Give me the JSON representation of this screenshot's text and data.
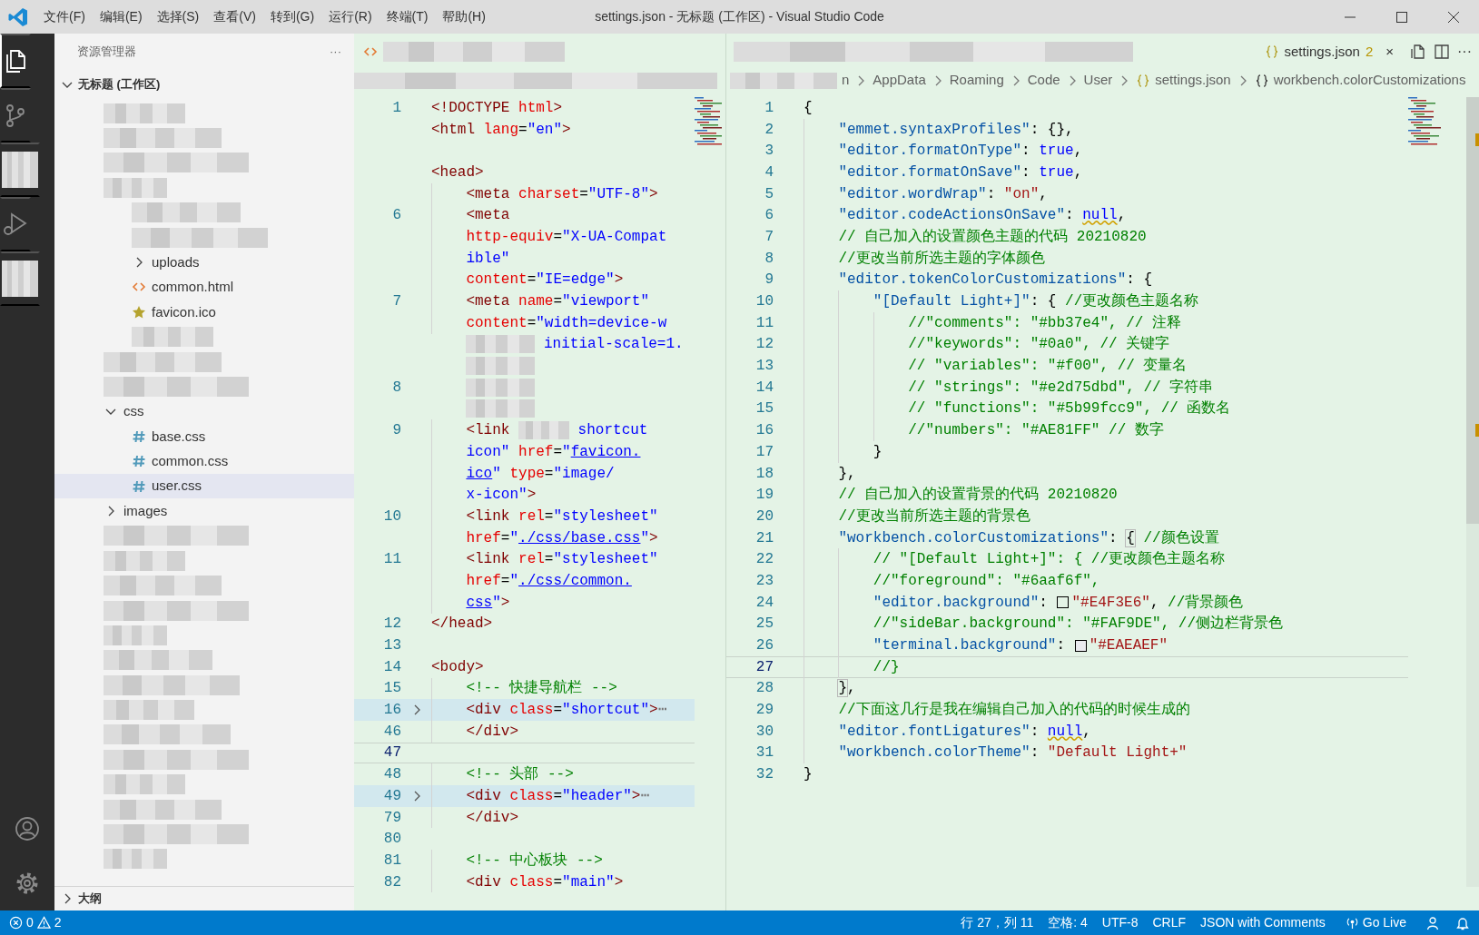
{
  "title_bar": {
    "menus": [
      "文件(F)",
      "编辑(E)",
      "选择(S)",
      "查看(V)",
      "转到(G)",
      "运行(R)",
      "终端(T)",
      "帮助(H)"
    ],
    "title": "settings.json - 无标题 (工作区) - Visual Studio Code"
  },
  "activity_bar": {
    "items": [
      {
        "kind": "files",
        "selected": true
      },
      {
        "kind": "source-control",
        "selected": false
      },
      {
        "kind": "redacted",
        "selected": false
      },
      {
        "kind": "run-debug",
        "selected": false
      },
      {
        "kind": "redacted",
        "selected": false
      }
    ],
    "bottom": [
      {
        "kind": "account"
      },
      {
        "kind": "settings"
      }
    ]
  },
  "explorer": {
    "title": "资源管理器",
    "more": "···",
    "workspace": {
      "label": "无标题 (工作区)",
      "expanded": true
    },
    "tree": [
      {
        "kind": "redacted",
        "selected": false
      },
      {
        "kind": "redacted",
        "selected": false
      },
      {
        "kind": "redacted",
        "selected": false
      },
      {
        "kind": "redacted",
        "selected": false,
        "children": [
          {
            "kind": "redacted",
            "selected": false
          },
          {
            "kind": "redacted",
            "selected": false
          },
          {
            "kind": "folder",
            "label": "uploads",
            "expanded": false,
            "selected": false
          },
          {
            "kind": "html",
            "label": "common.html",
            "selected": false
          },
          {
            "kind": "favicon",
            "label": "favicon.ico",
            "selected": false
          },
          {
            "kind": "redacted",
            "selected": false
          }
        ]
      },
      {
        "kind": "redacted",
        "selected": false
      },
      {
        "kind": "redacted",
        "selected": false
      },
      {
        "kind": "folder",
        "label": "css",
        "expanded": true,
        "selected": false,
        "children": [
          {
            "kind": "css",
            "label": "base.css",
            "selected": false
          },
          {
            "kind": "css",
            "label": "common.css",
            "selected": false
          },
          {
            "kind": "css",
            "label": "user.css",
            "selected": true
          }
        ]
      },
      {
        "kind": "folder",
        "label": "images",
        "expanded": false,
        "selected": false
      },
      {
        "kind": "redacted",
        "selected": false
      },
      {
        "kind": "redacted",
        "selected": false
      },
      {
        "kind": "redacted",
        "selected": false
      },
      {
        "kind": "redacted",
        "selected": false
      },
      {
        "kind": "redacted",
        "selected": false
      },
      {
        "kind": "redacted",
        "selected": false
      },
      {
        "kind": "redacted",
        "selected": false
      },
      {
        "kind": "redacted",
        "selected": false
      },
      {
        "kind": "redacted",
        "selected": false
      },
      {
        "kind": "redacted",
        "selected": false
      },
      {
        "kind": "redacted",
        "selected": false
      },
      {
        "kind": "redacted",
        "selected": false
      },
      {
        "kind": "redacted",
        "selected": false
      },
      {
        "kind": "redacted",
        "selected": false
      }
    ],
    "outline": {
      "label": "大纲",
      "expanded": false
    }
  },
  "editor_left": {
    "tabs": [
      {
        "kind": "html"
      }
    ],
    "rows": [
      {
        "number": "1",
        "current": false,
        "folded": false,
        "tokens": [
          {
            "kind": "tag",
            "text": "<!DOCTYPE"
          },
          {
            "kind": "attr",
            "text": " html"
          },
          {
            "kind": "tag",
            "text": ">"
          }
        ]
      },
      {
        "current": false,
        "folded": false,
        "tokens": [
          {
            "kind": "tag",
            "text": "<html"
          },
          {
            "kind": "attr",
            "text": " lang"
          },
          {
            "kind": "plain",
            "text": "="
          },
          {
            "kind": "string",
            "text": "\"en\""
          },
          {
            "kind": "tag",
            "text": ">"
          }
        ]
      },
      {
        "current": false,
        "folded": false
      },
      {
        "current": false,
        "folded": false,
        "tokens": [
          {
            "kind": "tag",
            "text": "<head>"
          }
        ]
      },
      {
        "current": false,
        "folded": false,
        "tokens": [
          {
            "kind": "tag",
            "text": "    <meta"
          },
          {
            "kind": "attr",
            "text": " charset"
          },
          {
            "kind": "plain",
            "text": "="
          },
          {
            "kind": "string",
            "text": "\"UTF-8\""
          },
          {
            "kind": "tag",
            "text": ">"
          }
        ]
      },
      {
        "number": "6",
        "current": false,
        "folded": false,
        "tokens": [
          {
            "kind": "tag",
            "text": "    <meta"
          }
        ]
      },
      {
        "current": false,
        "folded": false,
        "tokens": [
          {
            "kind": "attr",
            "text": "    http-equiv"
          },
          {
            "kind": "plain",
            "text": "="
          },
          {
            "kind": "string",
            "text": "\"X-UA-Compat"
          }
        ]
      },
      {
        "current": false,
        "folded": false,
        "tokens": [
          {
            "kind": "string",
            "text": "    ible\""
          }
        ]
      },
      {
        "current": false,
        "folded": false,
        "tokens": [
          {
            "kind": "attr",
            "text": "    content"
          },
          {
            "kind": "plain",
            "text": "="
          },
          {
            "kind": "string",
            "text": "\"IE=edge\""
          },
          {
            "kind": "tag",
            "text": ">"
          }
        ]
      },
      {
        "number": "7",
        "current": false,
        "folded": false,
        "tokens": [
          {
            "kind": "tag",
            "text": "    <meta"
          },
          {
            "kind": "attr",
            "text": " name"
          },
          {
            "kind": "plain",
            "text": "="
          },
          {
            "kind": "string",
            "text": "\"viewport\""
          }
        ]
      },
      {
        "current": false,
        "folded": false,
        "tokens": [
          {
            "kind": "attr",
            "text": "    content"
          },
          {
            "kind": "plain",
            "text": "="
          },
          {
            "kind": "string",
            "text": "\"width=device-w"
          }
        ]
      },
      {
        "current": false,
        "folded": false,
        "tokens": [
          {
            "kind": "redacted"
          },
          {
            "kind": "string",
            "text": " initial-scale=1."
          }
        ]
      },
      {
        "current": false,
        "folded": false,
        "tokens": [
          {
            "kind": "redacted"
          }
        ]
      },
      {
        "number": "8",
        "current": false,
        "folded": false,
        "tokens": [
          {
            "kind": "redacted"
          }
        ]
      },
      {
        "current": false,
        "folded": false,
        "tokens": [
          {
            "kind": "redacted"
          }
        ]
      },
      {
        "number": "9",
        "current": false,
        "folded": false,
        "tokens": [
          {
            "kind": "tag",
            "text": "    <link "
          },
          {
            "kind": "redacted"
          },
          {
            "kind": "string",
            "text": " shortcut"
          }
        ]
      },
      {
        "current": false,
        "folded": false,
        "tokens": [
          {
            "kind": "string",
            "text": "    icon\""
          },
          {
            "kind": "attr",
            "text": " href"
          },
          {
            "kind": "plain",
            "text": "="
          },
          {
            "kind": "string",
            "text": "\""
          },
          {
            "kind": "link",
            "text": "favicon."
          }
        ]
      },
      {
        "current": false,
        "folded": false,
        "tokens": [
          {
            "kind": "link",
            "text": "    ico"
          },
          {
            "kind": "string",
            "text": "\""
          },
          {
            "kind": "attr",
            "text": " type"
          },
          {
            "kind": "plain",
            "text": "="
          },
          {
            "kind": "string",
            "text": "\"image/"
          }
        ]
      },
      {
        "current": false,
        "folded": false,
        "tokens": [
          {
            "kind": "string",
            "text": "    x-icon\""
          },
          {
            "kind": "tag",
            "text": ">"
          }
        ]
      },
      {
        "number": "10",
        "current": false,
        "folded": false,
        "tokens": [
          {
            "kind": "tag",
            "text": "    <link"
          },
          {
            "kind": "attr",
            "text": " rel"
          },
          {
            "kind": "plain",
            "text": "="
          },
          {
            "kind": "string",
            "text": "\"stylesheet\""
          }
        ]
      },
      {
        "current": false,
        "folded": false,
        "tokens": [
          {
            "kind": "attr",
            "text": "    href"
          },
          {
            "kind": "plain",
            "text": "="
          },
          {
            "kind": "string",
            "text": "\""
          },
          {
            "kind": "link",
            "text": "./css/base.css"
          },
          {
            "kind": "string",
            "text": "\""
          },
          {
            "kind": "tag",
            "text": ">"
          }
        ]
      },
      {
        "number": "11",
        "current": false,
        "folded": false,
        "tokens": [
          {
            "kind": "tag",
            "text": "    <link"
          },
          {
            "kind": "attr",
            "text": " rel"
          },
          {
            "kind": "plain",
            "text": "="
          },
          {
            "kind": "string",
            "text": "\"stylesheet\""
          }
        ]
      },
      {
        "current": false,
        "folded": false,
        "tokens": [
          {
            "kind": "attr",
            "text": "    href"
          },
          {
            "kind": "plain",
            "text": "="
          },
          {
            "kind": "string",
            "text": "\""
          },
          {
            "kind": "link",
            "text": "./css/common."
          }
        ]
      },
      {
        "current": false,
        "folded": false,
        "tokens": [
          {
            "kind": "link",
            "text": "    css"
          },
          {
            "kind": "string",
            "text": "\""
          },
          {
            "kind": "tag",
            "text": ">"
          }
        ]
      },
      {
        "number": "12",
        "current": false,
        "folded": false,
        "tokens": [
          {
            "kind": "tag",
            "text": "</head>"
          }
        ]
      },
      {
        "number": "13",
        "current": false,
        "folded": false
      },
      {
        "number": "14",
        "current": false,
        "folded": false,
        "tokens": [
          {
            "kind": "tag",
            "text": "<body>"
          }
        ]
      },
      {
        "number": "15",
        "current": false,
        "folded": false,
        "tokens": [
          {
            "kind": "comment",
            "text": "    <!-- 快捷导航栏 -->"
          }
        ]
      },
      {
        "number": "16",
        "current": false,
        "folded": true,
        "tokens": [
          {
            "kind": "tag",
            "text": "    <div"
          },
          {
            "kind": "attr",
            "text": " class"
          },
          {
            "kind": "plain",
            "text": "="
          },
          {
            "kind": "string",
            "text": "\"shortcut\""
          },
          {
            "kind": "tag",
            "text": ">"
          },
          {
            "kind": "ellipsis",
            "text": "⋯"
          }
        ]
      },
      {
        "number": "46",
        "current": false,
        "folded": false,
        "tokens": [
          {
            "kind": "tag",
            "text": "    </div>"
          }
        ]
      },
      {
        "number": "47",
        "current": true,
        "folded": false
      },
      {
        "number": "48",
        "current": false,
        "folded": false,
        "tokens": [
          {
            "kind": "comment",
            "text": "    <!-- 头部 -->"
          }
        ]
      },
      {
        "number": "49",
        "current": false,
        "folded": true,
        "tokens": [
          {
            "kind": "tag",
            "text": "    <div"
          },
          {
            "kind": "attr",
            "text": " class"
          },
          {
            "kind": "plain",
            "text": "="
          },
          {
            "kind": "string",
            "text": "\"header\""
          },
          {
            "kind": "tag",
            "text": ">"
          },
          {
            "kind": "ellipsis",
            "text": "⋯"
          }
        ]
      },
      {
        "number": "79",
        "current": false,
        "folded": false,
        "tokens": [
          {
            "kind": "tag",
            "text": "    </div>"
          }
        ]
      },
      {
        "number": "80",
        "current": false,
        "folded": false
      },
      {
        "number": "81",
        "current": false,
        "folded": false,
        "tokens": [
          {
            "kind": "comment",
            "text": "    <!-- 中心板块 -->"
          }
        ]
      },
      {
        "number": "82",
        "current": false,
        "folded": false,
        "tokens": [
          {
            "kind": "tag",
            "text": "    <div"
          },
          {
            "kind": "attr",
            "text": " class"
          },
          {
            "kind": "plain",
            "text": "="
          },
          {
            "kind": "string",
            "text": "\"main\""
          },
          {
            "kind": "tag",
            "text": ">"
          }
        ]
      }
    ]
  },
  "editor_right": {
    "tabs": [
      {
        "kind": "redacted"
      },
      {
        "kind": "json",
        "label": "settings.json",
        "problems": "2",
        "close": "×",
        "selected": true
      }
    ],
    "more": "···",
    "breadcrumb": [
      {
        "kind": "folder",
        "text": "n"
      },
      {
        "kind": "folder",
        "text": "AppData"
      },
      {
        "kind": "folder",
        "text": "Roaming"
      },
      {
        "kind": "folder",
        "text": "Code"
      },
      {
        "kind": "folder",
        "text": "User"
      },
      {
        "kind": "json",
        "text": "settings.json"
      },
      {
        "kind": "object",
        "text": "workbench.colorCustomizations"
      }
    ],
    "rows": [
      {
        "number": "1",
        "current": false,
        "tokens": [
          {
            "kind": "plain",
            "text": "{"
          }
        ]
      },
      {
        "number": "2",
        "current": false,
        "tokens": [
          {
            "kind": "key",
            "text": "    \"emmet.syntaxProfiles\""
          },
          {
            "kind": "plain",
            "text": ": {},"
          }
        ]
      },
      {
        "number": "3",
        "current": false,
        "tokens": [
          {
            "kind": "key",
            "text": "    \"editor.formatOnType\""
          },
          {
            "kind": "plain",
            "text": ": "
          },
          {
            "kind": "keyword",
            "text": "true"
          },
          {
            "kind": "plain",
            "text": ","
          }
        ]
      },
      {
        "number": "4",
        "current": false,
        "tokens": [
          {
            "kind": "key",
            "text": "    \"editor.formatOnSave\""
          },
          {
            "kind": "plain",
            "text": ": "
          },
          {
            "kind": "keyword",
            "text": "true"
          },
          {
            "kind": "plain",
            "text": ","
          }
        ]
      },
      {
        "number": "5",
        "current": false,
        "tokens": [
          {
            "kind": "key",
            "text": "    \"editor.wordWrap\""
          },
          {
            "kind": "plain",
            "text": ": "
          },
          {
            "kind": "value",
            "text": "\"on\""
          },
          {
            "kind": "plain",
            "text": ","
          }
        ]
      },
      {
        "number": "6",
        "current": false,
        "tokens": [
          {
            "kind": "key",
            "text": "    \"editor.codeActionsOnSave\""
          },
          {
            "kind": "plain",
            "text": ": "
          },
          {
            "kind": "squiggle",
            "text": "null"
          },
          {
            "kind": "plain",
            "text": ","
          }
        ]
      },
      {
        "number": "7",
        "current": false,
        "tokens": [
          {
            "kind": "comment",
            "text": "    // 自己加入的设置颜色主题的代码 20210820"
          }
        ]
      },
      {
        "number": "8",
        "current": false,
        "tokens": [
          {
            "kind": "comment",
            "text": "    //更改当前所选主题的字体颜色"
          }
        ]
      },
      {
        "number": "9",
        "current": false,
        "tokens": [
          {
            "kind": "key",
            "text": "    \"editor.tokenColorCustomizations\""
          },
          {
            "kind": "plain",
            "text": ": {"
          }
        ]
      },
      {
        "number": "10",
        "current": false,
        "tokens": [
          {
            "kind": "key",
            "text": "        \"[Default Light+]\""
          },
          {
            "kind": "plain",
            "text": ": { "
          },
          {
            "kind": "comment",
            "text": "//更改颜色主题名称"
          }
        ]
      },
      {
        "number": "11",
        "current": false,
        "tokens": [
          {
            "kind": "comment",
            "text": "            //\"comments\": \"#bb37e4\", // 注释"
          }
        ]
      },
      {
        "number": "12",
        "current": false,
        "tokens": [
          {
            "kind": "comment",
            "text": "            //\"keywords\": \"#0a0\", // 关键字"
          }
        ]
      },
      {
        "number": "13",
        "current": false,
        "tokens": [
          {
            "kind": "comment",
            "text": "            // \"variables\": \"#f00\", // 变量名"
          }
        ]
      },
      {
        "number": "14",
        "current": false,
        "tokens": [
          {
            "kind": "comment",
            "text": "            // \"strings\": \"#e2d75dbd\", // 字符串"
          }
        ]
      },
      {
        "number": "15",
        "current": false,
        "tokens": [
          {
            "kind": "comment",
            "text": "            // \"functions\": \"#5b99fcc9\", // 函数名"
          }
        ]
      },
      {
        "number": "16",
        "current": false,
        "tokens": [
          {
            "kind": "comment",
            "text": "            //\"numbers\": \"#AE81FF\" // 数字"
          }
        ]
      },
      {
        "number": "17",
        "current": false,
        "tokens": [
          {
            "kind": "plain",
            "text": "        }"
          }
        ]
      },
      {
        "number": "18",
        "current": false,
        "tokens": [
          {
            "kind": "plain",
            "text": "    },"
          }
        ]
      },
      {
        "number": "19",
        "current": false,
        "tokens": [
          {
            "kind": "comment",
            "text": "    // 自己加入的设置背景的代码 20210820"
          }
        ]
      },
      {
        "number": "20",
        "current": false,
        "tokens": [
          {
            "kind": "comment",
            "text": "    //更改当前所选主题的背景色"
          }
        ]
      },
      {
        "number": "21",
        "current": false,
        "tokens": [
          {
            "kind": "key",
            "text": "    \"workbench.colorCustomizations\""
          },
          {
            "kind": "plain",
            "text": ": "
          },
          {
            "kind": "bracket",
            "text": "{"
          },
          {
            "kind": "comment",
            "text": " //颜色设置"
          }
        ]
      },
      {
        "number": "22",
        "current": false,
        "tokens": [
          {
            "kind": "comment",
            "text": "        // \"[Default Light+]\": { //更改颜色主题名称"
          }
        ]
      },
      {
        "number": "23",
        "current": false,
        "tokens": [
          {
            "kind": "comment",
            "text": "        //\"foreground\": \"#6aaf6f\","
          }
        ]
      },
      {
        "number": "24",
        "current": false,
        "tokens": [
          {
            "kind": "key",
            "text": "        \"editor.background\""
          },
          {
            "kind": "plain",
            "text": ": "
          },
          {
            "kind": "swatch",
            "color": "#e4f3e6"
          },
          {
            "kind": "value",
            "text": "\"#E4F3E6\""
          },
          {
            "kind": "plain",
            "text": ", "
          },
          {
            "kind": "comment",
            "text": "//背景颜色"
          }
        ]
      },
      {
        "number": "25",
        "current": false,
        "tokens": [
          {
            "kind": "comment",
            "text": "        //\"sideBar.background\": \"#FAF9DE\", //侧边栏背景色"
          }
        ]
      },
      {
        "number": "26",
        "current": false,
        "tokens": [
          {
            "kind": "key",
            "text": "        \"terminal.background\""
          },
          {
            "kind": "plain",
            "text": ": "
          },
          {
            "kind": "swatch",
            "color": "#eaeaef"
          },
          {
            "kind": "value",
            "text": "\"#EAEAEF\""
          }
        ]
      },
      {
        "number": "27",
        "current": true,
        "tokens": [
          {
            "kind": "comment",
            "text": "        //}"
          }
        ]
      },
      {
        "number": "28",
        "current": false,
        "tokens": [
          {
            "kind": "bracket",
            "text": "    }"
          },
          {
            "kind": "plain",
            "text": ","
          }
        ]
      },
      {
        "number": "29",
        "current": false,
        "tokens": [
          {
            "kind": "comment",
            "text": "    //下面这几行是我在编辑自己加入的代码的时候生成的"
          }
        ]
      },
      {
        "number": "30",
        "current": false,
        "tokens": [
          {
            "kind": "key",
            "text": "    \"editor.fontLigatures\""
          },
          {
            "kind": "plain",
            "text": ": "
          },
          {
            "kind": "squiggle",
            "text": "null"
          },
          {
            "kind": "plain",
            "text": ","
          }
        ]
      },
      {
        "number": "31",
        "current": false,
        "tokens": [
          {
            "kind": "key",
            "text": "    \"workbench.colorTheme\""
          },
          {
            "kind": "plain",
            "text": ": "
          },
          {
            "kind": "value",
            "text": "\"Default Light+\""
          }
        ]
      },
      {
        "number": "32",
        "current": false,
        "tokens": [
          {
            "kind": "plain",
            "text": "}"
          }
        ]
      }
    ]
  },
  "status_bar": {
    "errors": "0",
    "warnings": "2",
    "items": [
      "行 27，列 11",
      "空格: 4",
      "UTF-8",
      "CRLF",
      "JSON with Comments"
    ],
    "go_live": "Go Live"
  }
}
